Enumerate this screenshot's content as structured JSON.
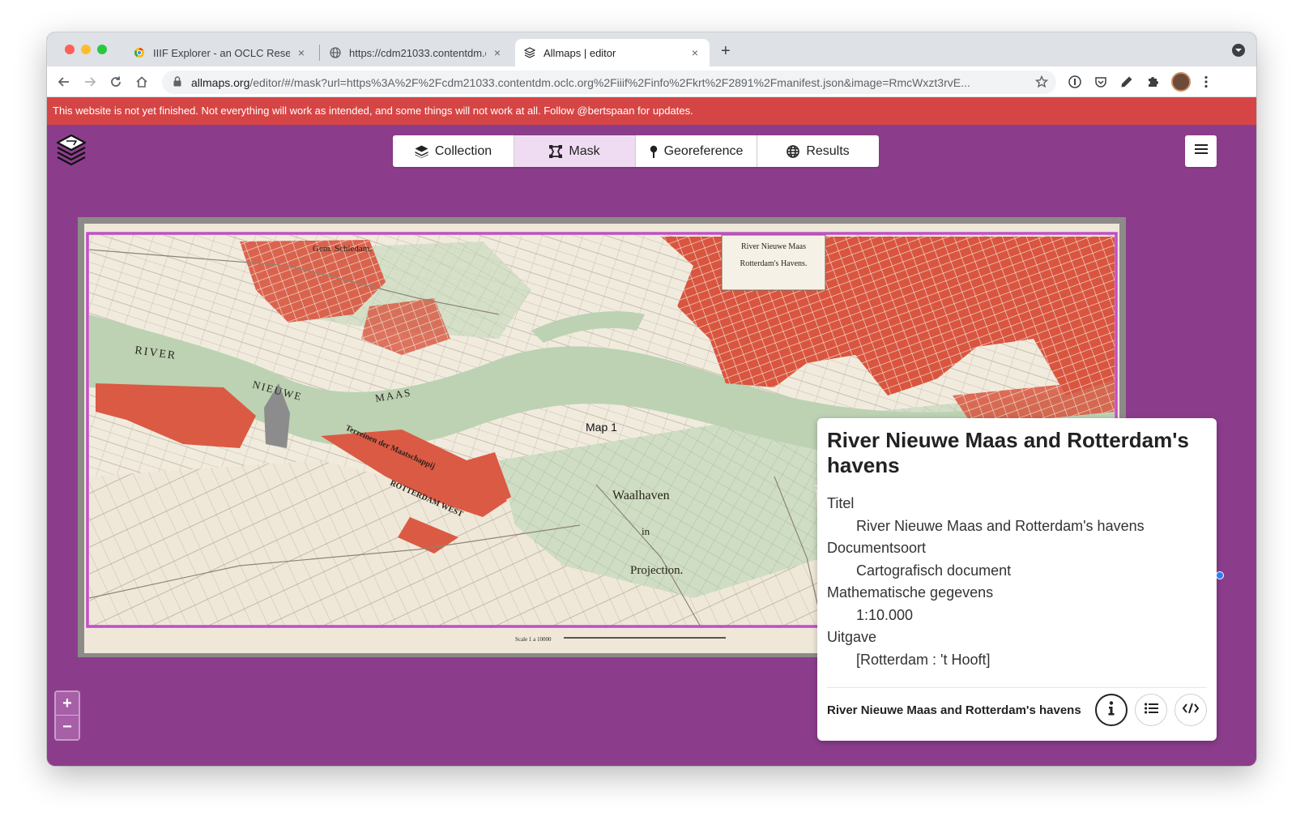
{
  "browser": {
    "tabs": [
      {
        "title": "IIIF Explorer - an OCLC Resear",
        "close": "×"
      },
      {
        "title": "https://cdm21033.contentdm.o",
        "close": "×"
      },
      {
        "title": "Allmaps | editor",
        "close": "×"
      }
    ],
    "new_tab": "+",
    "url_host": "allmaps.org",
    "url_rest": "/editor/#/mask?url=https%3A%2F%2Fcdm21033.contentdm.oclc.org%2Fiiif%2Finfo%2Fkrt%2F2891%2Fmanifest.json&image=RmcWxzt3rvE..."
  },
  "banner": {
    "text": "This website is not yet finished. Not everything will work as intended, and some things will not work at all. Follow @bertspaan for updates.",
    "color": "#d64545"
  },
  "app": {
    "background": "#8b3d8c",
    "nav": [
      {
        "label": "Collection",
        "icon": "layers-icon"
      },
      {
        "label": "Mask",
        "icon": "mask-icon",
        "active": true
      },
      {
        "label": "Georeference",
        "icon": "pin-icon"
      },
      {
        "label": "Results",
        "icon": "globe-icon"
      }
    ],
    "menu_icon": "hamburger-icon"
  },
  "map": {
    "label": "Map 1",
    "zoom_in": "+",
    "zoom_out": "−",
    "labels": {
      "river": "RIVER",
      "nieuwe": "NIEUWE",
      "maas": "MAAS",
      "schiedam": "Gem. Schiedam.",
      "waalhaven": "Waalhaven",
      "in": "in",
      "projection": "Projection.",
      "title1": "River Nieuwe Maas",
      "title2": "Rotterdam's Havens.",
      "rotterdam_west": "ROTTERDAM WEST",
      "terreinen": "Terreinen der Maatschappij",
      "scale": "Scale 1 a 10000"
    }
  },
  "panel": {
    "title": "River Nieuwe Maas and Rotterdam's havens",
    "fields": [
      {
        "label": "Titel",
        "value": "River Nieuwe Maas and Rotterdam's havens"
      },
      {
        "label": "Documentsoort",
        "value": "Cartografisch document"
      },
      {
        "label": "Mathematische gegevens",
        "value": "1:10.000"
      },
      {
        "label": "Uitgave",
        "value": "[Rotterdam : 't Hooft]"
      }
    ],
    "footer_title": "River Nieuwe Maas and Rotterdam's havens",
    "buttons": [
      "info-icon",
      "list-icon",
      "code-icon"
    ]
  }
}
